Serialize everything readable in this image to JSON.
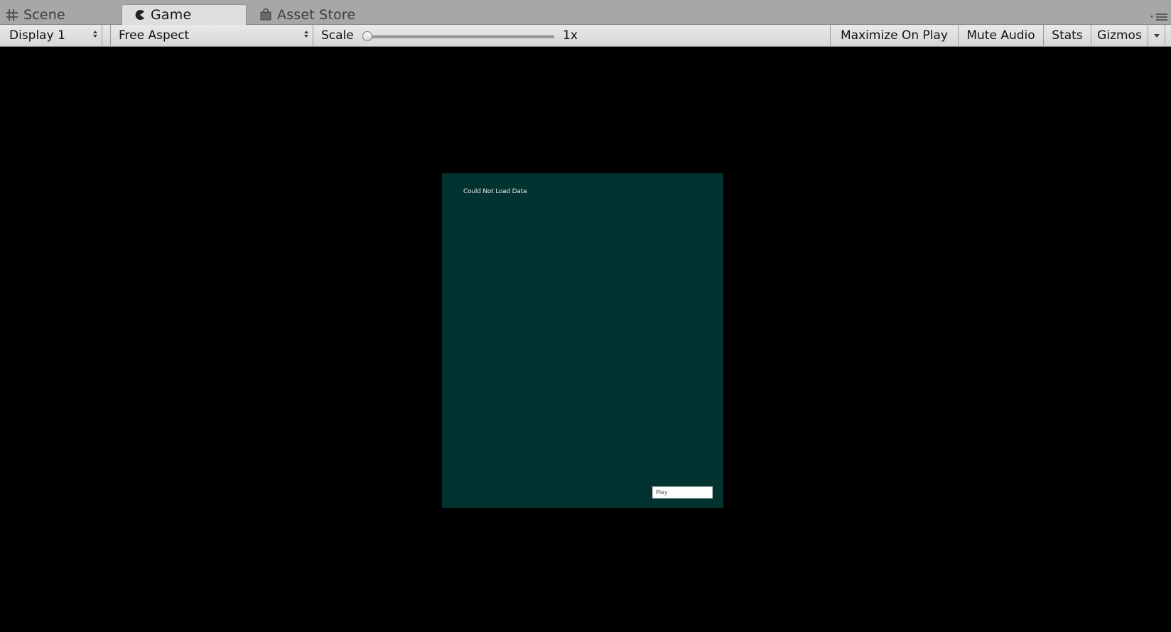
{
  "tabs": [
    {
      "label": "Scene",
      "icon": "grid-icon",
      "active": false
    },
    {
      "label": "Game",
      "icon": "pacman-icon",
      "active": true
    },
    {
      "label": "Asset Store",
      "icon": "shopping-bag-icon",
      "active": false
    }
  ],
  "tab_menu_icon": "panel-menu-icon",
  "toolbar": {
    "display": "Display 1",
    "aspect": "Free Aspect",
    "scale_label": "Scale",
    "scale_value": "1x",
    "scale_slider_fraction": 0.0,
    "maximize_on_play": "Maximize On Play",
    "mute_audio": "Mute Audio",
    "stats": "Stats",
    "gizmos": "Gizmos"
  },
  "game": {
    "background_color": "#000000",
    "canvas_color": "#033330",
    "label_text": "Could Not Load Data",
    "input_text": "Play"
  }
}
